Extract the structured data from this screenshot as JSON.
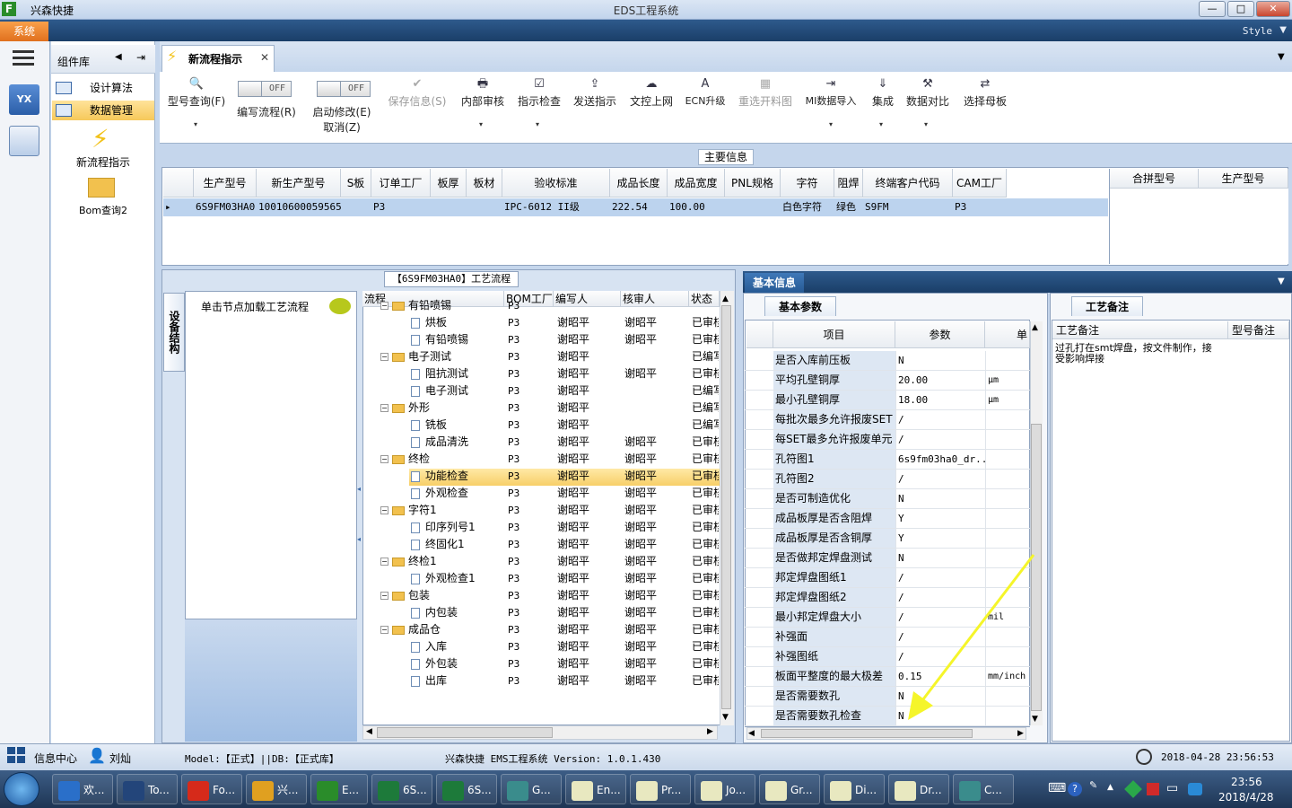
{
  "window": {
    "app_name": "兴森快捷",
    "title": "EDS工程系统",
    "min": "—",
    "max": "□",
    "close": "✕"
  },
  "ribbon": {
    "system_tab": "系统",
    "style_label": "Style",
    "style_dd": "▼"
  },
  "component_library": {
    "title": "组件库",
    "items": [
      {
        "label": "设计算法"
      },
      {
        "label": "数据管理"
      }
    ],
    "big_items": [
      {
        "label": "新流程指示"
      },
      {
        "label": "Bom查询2"
      }
    ]
  },
  "doc_tab": {
    "label": "新流程指示",
    "close": "✕"
  },
  "toolbar": {
    "buttons": [
      {
        "label": "型号查询(F)",
        "icon": "🔍"
      },
      {
        "label": "保存信息(S)",
        "icon": "✔"
      },
      {
        "label": "内部审核",
        "icon": "🖶"
      },
      {
        "label": "指示检查",
        "icon": "☑"
      },
      {
        "label": "发送指示",
        "icon": "⇪"
      },
      {
        "label": "文控上网",
        "icon": "☁"
      },
      {
        "label": "ECN升级",
        "icon": "A"
      },
      {
        "label": "重选开料图",
        "icon": "▦"
      },
      {
        "label": "MI数据导入",
        "icon": "⇥"
      },
      {
        "label": "集成",
        "icon": "⇓"
      },
      {
        "label": "数据对比",
        "icon": "⚒"
      },
      {
        "label": "选择母板",
        "icon": "⇄"
      }
    ],
    "toggles": [
      {
        "state": "OFF",
        "label": "编写流程(R)"
      },
      {
        "state": "OFF",
        "label": "启动修改(E)",
        "label2": "取消(Z)"
      }
    ],
    "dropdown": "▾"
  },
  "main_info": {
    "title": "主要信息",
    "columns": [
      "生产型号",
      "新生产型号",
      "S板",
      "订单工厂",
      "板厚",
      "板材",
      "验收标准",
      "成品长度",
      "成品宽度",
      "PNL规格",
      "字符",
      "阻焊",
      "终端客户代码",
      "CAM工厂"
    ],
    "row": [
      "6S9FM03HA0",
      "10010600059565",
      "",
      "P3",
      "",
      "",
      "IPC-6012 II级",
      "222.54",
      "100.00",
      "",
      "白色字符",
      "绿色",
      "S9FM",
      "P3"
    ],
    "row_marker": "▸",
    "merge_columns": [
      "合拼型号",
      "生产型号"
    ]
  },
  "flow": {
    "title": "【6S9FM03HA0】工艺流程",
    "vertical_tab": "设备结构",
    "node_hint": "单击节点加载工艺流程",
    "columns": [
      "流程",
      "BOM工厂",
      "编写人",
      "核审人",
      "状态"
    ],
    "rows": [
      {
        "name": "有铅喷锡",
        "level": 0,
        "type": "folder",
        "bom": "P3",
        "writer": "",
        "reviewer": "",
        "status": ""
      },
      {
        "name": "烘板",
        "level": 1,
        "type": "doc",
        "bom": "P3",
        "writer": "谢昭平",
        "reviewer": "谢昭平",
        "status": "已审核"
      },
      {
        "name": "有铅喷锡",
        "level": 1,
        "type": "doc",
        "bom": "P3",
        "writer": "谢昭平",
        "reviewer": "谢昭平",
        "status": "已审核"
      },
      {
        "name": "电子测试",
        "level": 0,
        "type": "folder",
        "bom": "P3",
        "writer": "谢昭平",
        "reviewer": "",
        "status": "已编写"
      },
      {
        "name": "阻抗测试",
        "level": 1,
        "type": "doc",
        "bom": "P3",
        "writer": "谢昭平",
        "reviewer": "谢昭平",
        "status": "已审核"
      },
      {
        "name": "电子测试",
        "level": 1,
        "type": "doc",
        "bom": "P3",
        "writer": "谢昭平",
        "reviewer": "",
        "status": "已编写"
      },
      {
        "name": "外形",
        "level": 0,
        "type": "folder",
        "bom": "P3",
        "writer": "谢昭平",
        "reviewer": "",
        "status": "已编写"
      },
      {
        "name": "铣板",
        "level": 1,
        "type": "doc",
        "bom": "P3",
        "writer": "谢昭平",
        "reviewer": "",
        "status": "已编写"
      },
      {
        "name": "成品清洗",
        "level": 1,
        "type": "doc",
        "bom": "P3",
        "writer": "谢昭平",
        "reviewer": "谢昭平",
        "status": "已审核"
      },
      {
        "name": "终检",
        "level": 0,
        "type": "folder",
        "bom": "P3",
        "writer": "谢昭平",
        "reviewer": "谢昭平",
        "status": "已审核"
      },
      {
        "name": "功能检查",
        "level": 1,
        "type": "doc",
        "bom": "P3",
        "writer": "谢昭平",
        "reviewer": "谢昭平",
        "status": "已审核"
      },
      {
        "name": "外观检查",
        "level": 1,
        "type": "doc",
        "bom": "P3",
        "writer": "谢昭平",
        "reviewer": "谢昭平",
        "status": "已审核"
      },
      {
        "name": "字符1",
        "level": 0,
        "type": "folder",
        "bom": "P3",
        "writer": "谢昭平",
        "reviewer": "谢昭平",
        "status": "已审核"
      },
      {
        "name": "印序列号1",
        "level": 1,
        "type": "doc",
        "bom": "P3",
        "writer": "谢昭平",
        "reviewer": "谢昭平",
        "status": "已审核"
      },
      {
        "name": "终固化1",
        "level": 1,
        "type": "doc",
        "bom": "P3",
        "writer": "谢昭平",
        "reviewer": "谢昭平",
        "status": "已审核"
      },
      {
        "name": "终检1",
        "level": 0,
        "type": "folder",
        "bom": "P3",
        "writer": "谢昭平",
        "reviewer": "谢昭平",
        "status": "已审核"
      },
      {
        "name": "外观检查1",
        "level": 1,
        "type": "doc",
        "bom": "P3",
        "writer": "谢昭平",
        "reviewer": "谢昭平",
        "status": "已审核"
      },
      {
        "name": "包装",
        "level": 0,
        "type": "folder",
        "bom": "P3",
        "writer": "谢昭平",
        "reviewer": "谢昭平",
        "status": "已审核"
      },
      {
        "name": "内包装",
        "level": 1,
        "type": "doc",
        "bom": "P3",
        "writer": "谢昭平",
        "reviewer": "谢昭平",
        "status": "已审核"
      },
      {
        "name": "成品仓",
        "level": 0,
        "type": "folder",
        "bom": "P3",
        "writer": "谢昭平",
        "reviewer": "谢昭平",
        "status": "已审核"
      },
      {
        "name": "入库",
        "level": 1,
        "type": "doc",
        "bom": "P3",
        "writer": "谢昭平",
        "reviewer": "谢昭平",
        "status": "已审核"
      },
      {
        "name": "外包装",
        "level": 1,
        "type": "doc",
        "bom": "P3",
        "writer": "谢昭平",
        "reviewer": "谢昭平",
        "status": "已审核"
      },
      {
        "name": "出库",
        "level": 1,
        "type": "doc",
        "bom": "P3",
        "writer": "谢昭平",
        "reviewer": "谢昭平",
        "status": "已审核"
      }
    ],
    "selected_index": 10
  },
  "basic_info": {
    "strip_tab": "基本信息",
    "params_tab": "基本参数",
    "columns": [
      "项目",
      "参数",
      "单"
    ],
    "rows": [
      {
        "item": "是否入库前压板",
        "value": "N",
        "unit": ""
      },
      {
        "item": "平均孔壁铜厚",
        "value": "20.00",
        "unit": "μm"
      },
      {
        "item": "最小孔壁铜厚",
        "value": "18.00",
        "unit": "μm"
      },
      {
        "item": "每批次最多允许报废SET",
        "value": "/",
        "unit": ""
      },
      {
        "item": "每SET最多允许报废单元",
        "value": "/",
        "unit": ""
      },
      {
        "item": "孔符图1",
        "value": "6s9fm03ha0_dr...",
        "unit": ""
      },
      {
        "item": "孔符图2",
        "value": "/",
        "unit": ""
      },
      {
        "item": "是否可制造优化",
        "value": "N",
        "unit": ""
      },
      {
        "item": "成品板厚是否含阻焊",
        "value": "Y",
        "unit": ""
      },
      {
        "item": "成品板厚是否含铜厚",
        "value": "Y",
        "unit": ""
      },
      {
        "item": "是否做邦定焊盘测试",
        "value": "N",
        "unit": ""
      },
      {
        "item": "邦定焊盘图纸1",
        "value": "/",
        "unit": ""
      },
      {
        "item": "邦定焊盘图纸2",
        "value": "/",
        "unit": ""
      },
      {
        "item": "最小邦定焊盘大小",
        "value": "/",
        "unit": "mil"
      },
      {
        "item": "补强面",
        "value": "/",
        "unit": ""
      },
      {
        "item": "补强图纸",
        "value": "/",
        "unit": ""
      },
      {
        "item": "板面平整度的最大极差",
        "value": "0.15",
        "unit": "mm/inch"
      },
      {
        "item": "是否需要数孔",
        "value": "N",
        "unit": ""
      },
      {
        "item": "是否需要数孔检查",
        "value": "N",
        "unit": ""
      }
    ]
  },
  "craft_notes": {
    "tab": "工艺备注",
    "columns": [
      "工艺备注",
      "型号备注"
    ],
    "note": "过孔打在smt焊盘，按文件制作，接受影响焊接"
  },
  "statusbar": {
    "info_center": "信息中心",
    "user": "刘灿",
    "model": "Model:【正式】||DB:【正式库】",
    "version": "兴森快捷 EMS工程系统 Version: 1.0.1.430",
    "datetime": "2018-04-28 23:56:53"
  },
  "taskbar": {
    "items": [
      {
        "label": "欢...",
        "color": "#2a6fc9"
      },
      {
        "label": "To...",
        "color": "#23457a"
      },
      {
        "label": "Fo...",
        "color": "#d62a1a"
      },
      {
        "label": "兴...",
        "color": "#e0a020"
      },
      {
        "label": "E...",
        "color": "#2a8c2a"
      },
      {
        "label": "6S...",
        "color": "#1d7a3a"
      },
      {
        "label": "6S...",
        "color": "#1d7a3a"
      },
      {
        "label": "G...",
        "color": "#3a8c8c"
      },
      {
        "label": "En...",
        "color": "#e8e8c0"
      },
      {
        "label": "Pr...",
        "color": "#e8e8c0"
      },
      {
        "label": "Jo...",
        "color": "#e8e8c0"
      },
      {
        "label": "Gr...",
        "color": "#e8e8c0"
      },
      {
        "label": "Di...",
        "color": "#e8e8c0"
      },
      {
        "label": "Dr...",
        "color": "#e8e8c0"
      },
      {
        "label": "C...",
        "color": "#3a8c8c"
      }
    ],
    "time": "23:56",
    "date": "2018/4/28"
  },
  "colors": {
    "accent": "#1a3e68",
    "selection": "#f7cf68",
    "annotation_arrow": "#f5f52a"
  }
}
